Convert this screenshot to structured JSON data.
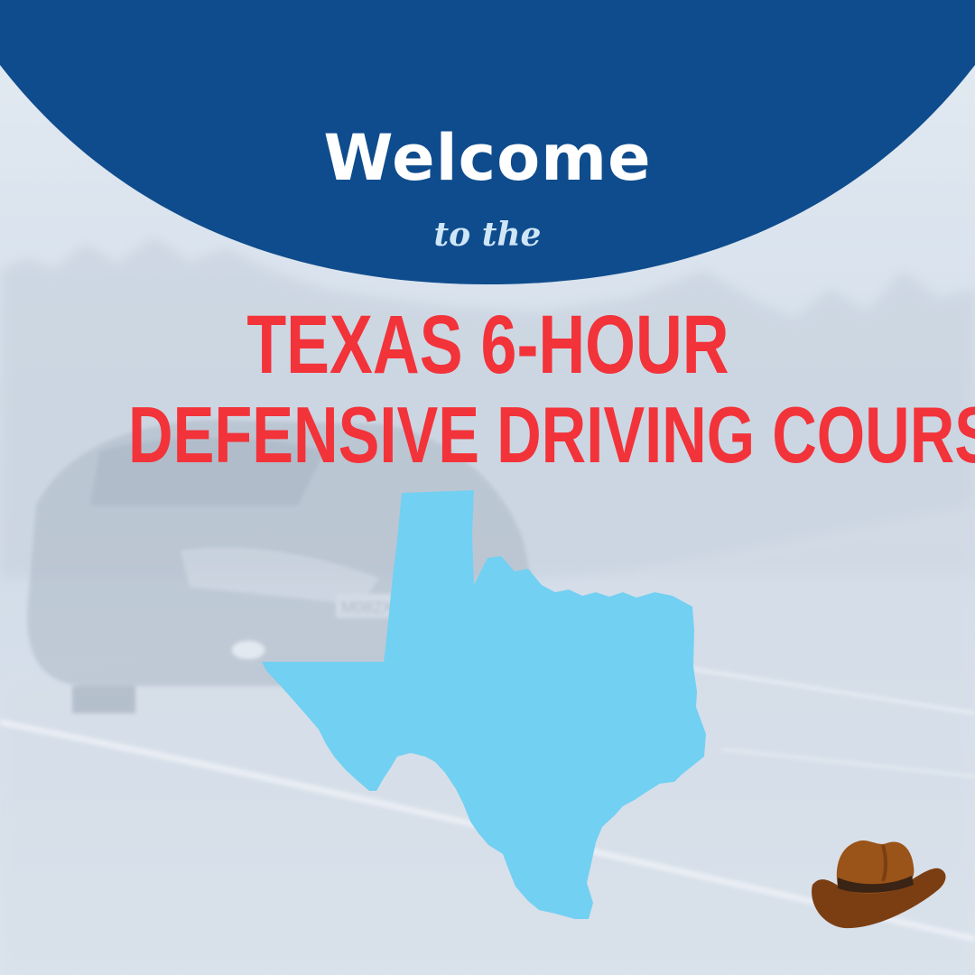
{
  "banner": {
    "welcome": "Welcome",
    "subtitle": "to the",
    "color": "#0f4c8d"
  },
  "headline": {
    "line1": "TEXAS 6-HOUR",
    "line2": "DEFENSIVE DRIVING COURSE",
    "color": "#f2333a"
  },
  "graphics": {
    "map_icon": "texas-map-icon",
    "map_color": "#72d0f2",
    "hat_icon": "cowboy-hat-icon",
    "hat_color": "#8b4513",
    "plate_text": "M082X"
  }
}
